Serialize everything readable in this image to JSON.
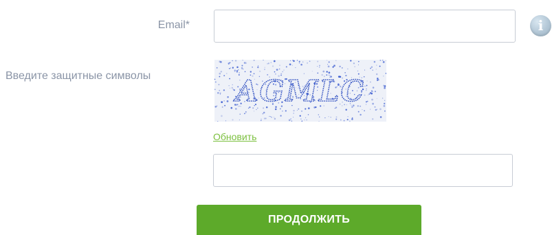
{
  "email": {
    "label": "Email*",
    "value": "",
    "placeholder": ""
  },
  "captcha": {
    "label": "Введите защитные символы",
    "image_text": "AGMLC",
    "refresh_label": "Обновить",
    "input_value": "",
    "input_placeholder": ""
  },
  "submit": {
    "label": "ПРОДОЛЖИТЬ"
  },
  "colors": {
    "accent": "#5daa2a",
    "link": "#7cc03f",
    "label": "#8a94a6",
    "border": "#c7ccd4",
    "captcha_ink": "#2f4fc0"
  },
  "icons": {
    "info": "info-icon"
  }
}
